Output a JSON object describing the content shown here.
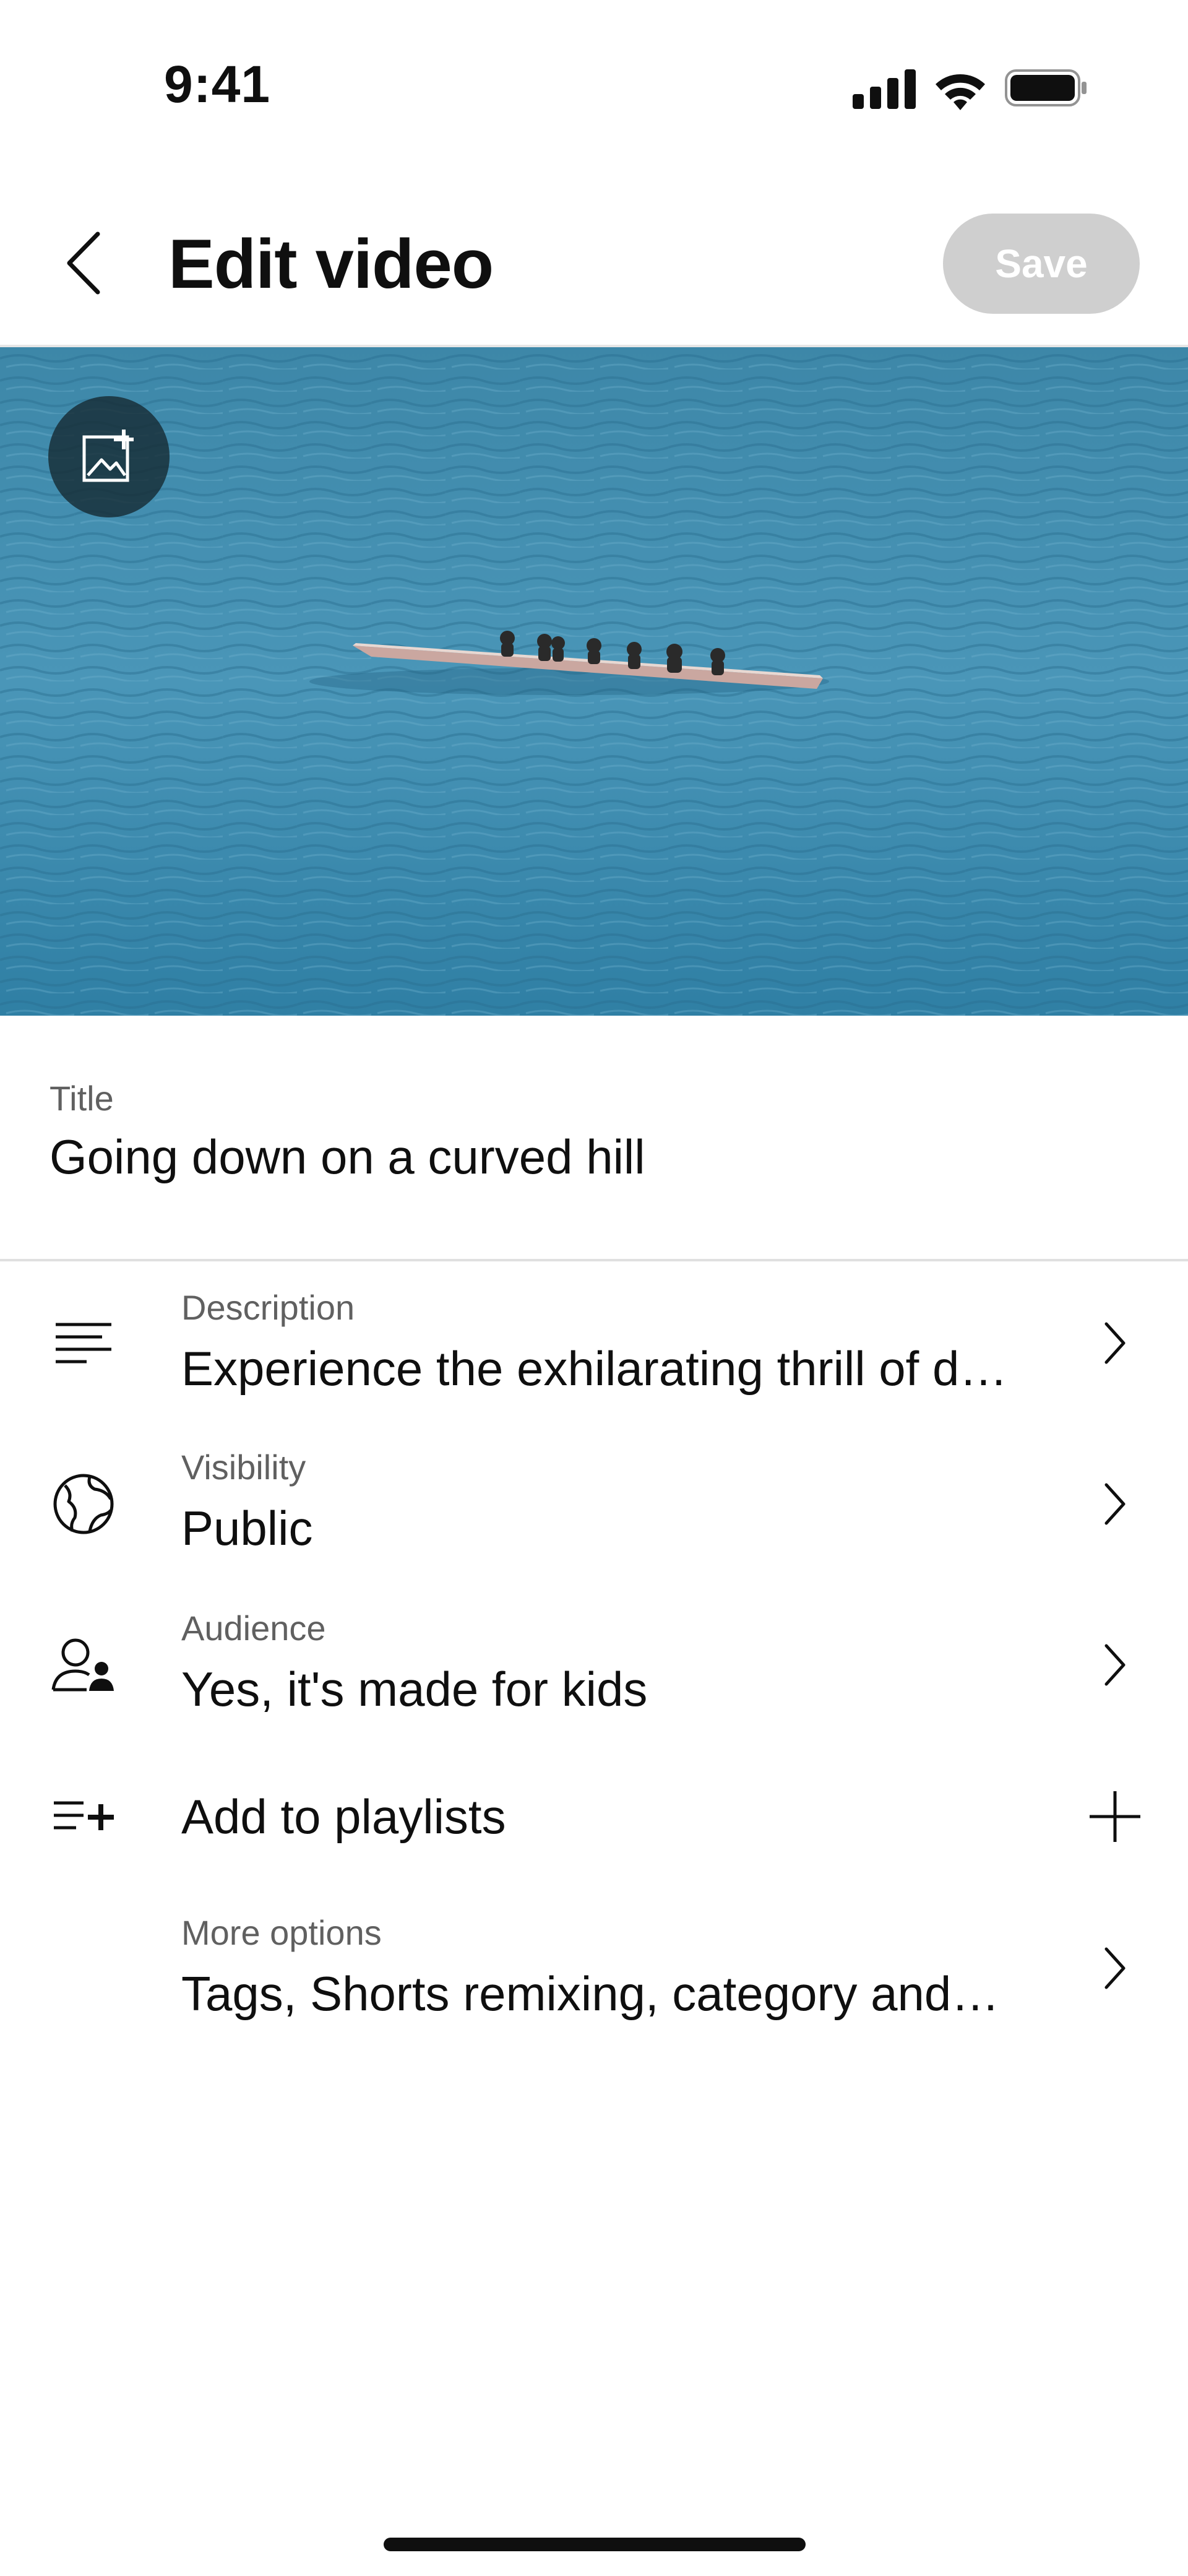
{
  "status_bar": {
    "time": "9:41"
  },
  "header": {
    "title": "Edit video",
    "save_label": "Save"
  },
  "video": {
    "title_label": "Title",
    "title_value": "Going down on a curved hill"
  },
  "rows": [
    {
      "label": "Description",
      "value": "Experience the exhilarating thrill of d…",
      "icon": "description-icon"
    },
    {
      "label": "Visibility",
      "value": "Public",
      "icon": "globe-icon"
    },
    {
      "label": "Audience",
      "value": "Yes, it's made for kids",
      "icon": "audience-icon"
    },
    {
      "label": "",
      "value": "Add to playlists",
      "icon": "playlist-add-icon"
    },
    {
      "label": "More options",
      "value": "Tags, Shorts remixing, category and…",
      "icon": ""
    }
  ],
  "colors": {
    "save_disabled": "#cfcfcf",
    "water": "#3f8fb0",
    "text": "#0f0f0f",
    "secondary_text": "#606060"
  }
}
